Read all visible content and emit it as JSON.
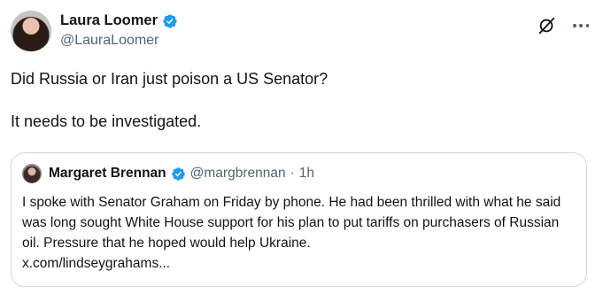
{
  "tweet": {
    "author": {
      "display_name": "Laura Loomer",
      "handle": "@LauraLoomer",
      "verified_color": "#1d9bf0"
    },
    "text_line1": "Did Russia or Iran just poison a US Senator?",
    "text_line2": "It needs to be investigated.",
    "icons": {
      "grok": "grok-icon",
      "more": "more-icon"
    }
  },
  "quote": {
    "author": {
      "display_name": "Margaret Brennan",
      "handle": "@margbrennan",
      "separator": "·",
      "time": "1h"
    },
    "text": "I spoke with Senator Graham on Friday by phone. He had been thrilled with what he said was long sought White House support for his plan to put tariffs on purchasers of Russian oil. Pressure that he hoped would help Ukraine.",
    "link": "x.com/lindseygrahams..."
  }
}
